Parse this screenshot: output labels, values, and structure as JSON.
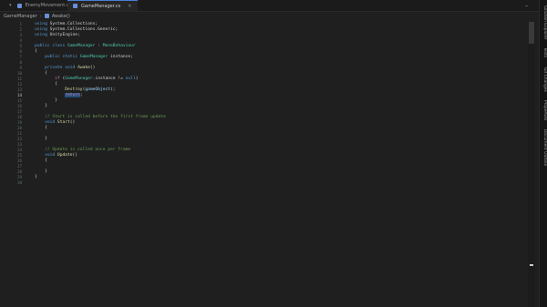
{
  "tabs": [
    {
      "label": "EnemyMovement.cs",
      "active": false,
      "icon_color": "#6a8fd8"
    },
    {
      "label": "GameManager.cs",
      "active": true,
      "icon_color": "#6a8fd8"
    }
  ],
  "tabbar_overflow": "…",
  "breadcrumb": [
    "GameManager",
    "Awake()"
  ],
  "right_panel": [
    "Solution Explorer",
    "Tests",
    "Git Changes",
    "Properties",
    "Document Outline"
  ],
  "current_line": 14,
  "code_lines": [
    [
      {
        "t": "using ",
        "c": "kw"
      },
      {
        "t": "System.Collections;"
      }
    ],
    [
      {
        "t": "using ",
        "c": "kw"
      },
      {
        "t": "System.Collections.Generic;"
      }
    ],
    [
      {
        "t": "using ",
        "c": "kw"
      },
      {
        "t": "UnityEngine;"
      }
    ],
    [],
    [
      {
        "t": "public ",
        "c": "kw"
      },
      {
        "t": "class ",
        "c": "kw"
      },
      {
        "t": "GameManager",
        "c": "ty"
      },
      {
        "t": " : "
      },
      {
        "t": "MonoBehaviour",
        "c": "ty"
      }
    ],
    [
      {
        "t": "{"
      }
    ],
    [
      {
        "t": "    "
      },
      {
        "t": "public ",
        "c": "kw"
      },
      {
        "t": "static ",
        "c": "kw"
      },
      {
        "t": "GameManager",
        "c": "ty"
      },
      {
        "t": " instance;"
      }
    ],
    [],
    [
      {
        "t": "    "
      },
      {
        "t": "private ",
        "c": "kw"
      },
      {
        "t": "void ",
        "c": "kw"
      },
      {
        "t": "Awake",
        "c": "fn"
      },
      {
        "t": "()"
      }
    ],
    [
      {
        "t": "    {"
      }
    ],
    [
      {
        "t": "        "
      },
      {
        "t": "if ",
        "c": "ctl"
      },
      {
        "t": "("
      },
      {
        "t": "GameManager",
        "c": "ty"
      },
      {
        "t": ".instance != "
      },
      {
        "t": "null",
        "c": "kw"
      },
      {
        "t": ")"
      }
    ],
    [
      {
        "t": "        {"
      }
    ],
    [
      {
        "t": "            "
      },
      {
        "t": "Destroy",
        "c": "fn"
      },
      {
        "t": "("
      },
      {
        "t": "gameObject",
        "c": "vr"
      },
      {
        "t": ");"
      }
    ],
    [
      {
        "t": "            "
      },
      {
        "t": "return",
        "c": "ctl sel"
      },
      {
        "t": ";"
      }
    ],
    [
      {
        "t": "        }"
      }
    ],
    [
      {
        "t": "    }"
      }
    ],
    [],
    [
      {
        "t": "    "
      },
      {
        "t": "// Start is called before the first frame update",
        "c": "cm"
      }
    ],
    [
      {
        "t": "    "
      },
      {
        "t": "void ",
        "c": "kw"
      },
      {
        "t": "Start",
        "c": "fn"
      },
      {
        "t": "()"
      }
    ],
    [
      {
        "t": "    {"
      }
    ],
    [],
    [
      {
        "t": "    }"
      }
    ],
    [],
    [
      {
        "t": "    "
      },
      {
        "t": "// Update is called once per frame",
        "c": "cm"
      }
    ],
    [
      {
        "t": "    "
      },
      {
        "t": "void ",
        "c": "kw"
      },
      {
        "t": "Update",
        "c": "fn"
      },
      {
        "t": "()"
      }
    ],
    [
      {
        "t": "    {"
      }
    ],
    [],
    [
      {
        "t": "    }"
      }
    ],
    [
      {
        "t": "}"
      }
    ],
    []
  ]
}
